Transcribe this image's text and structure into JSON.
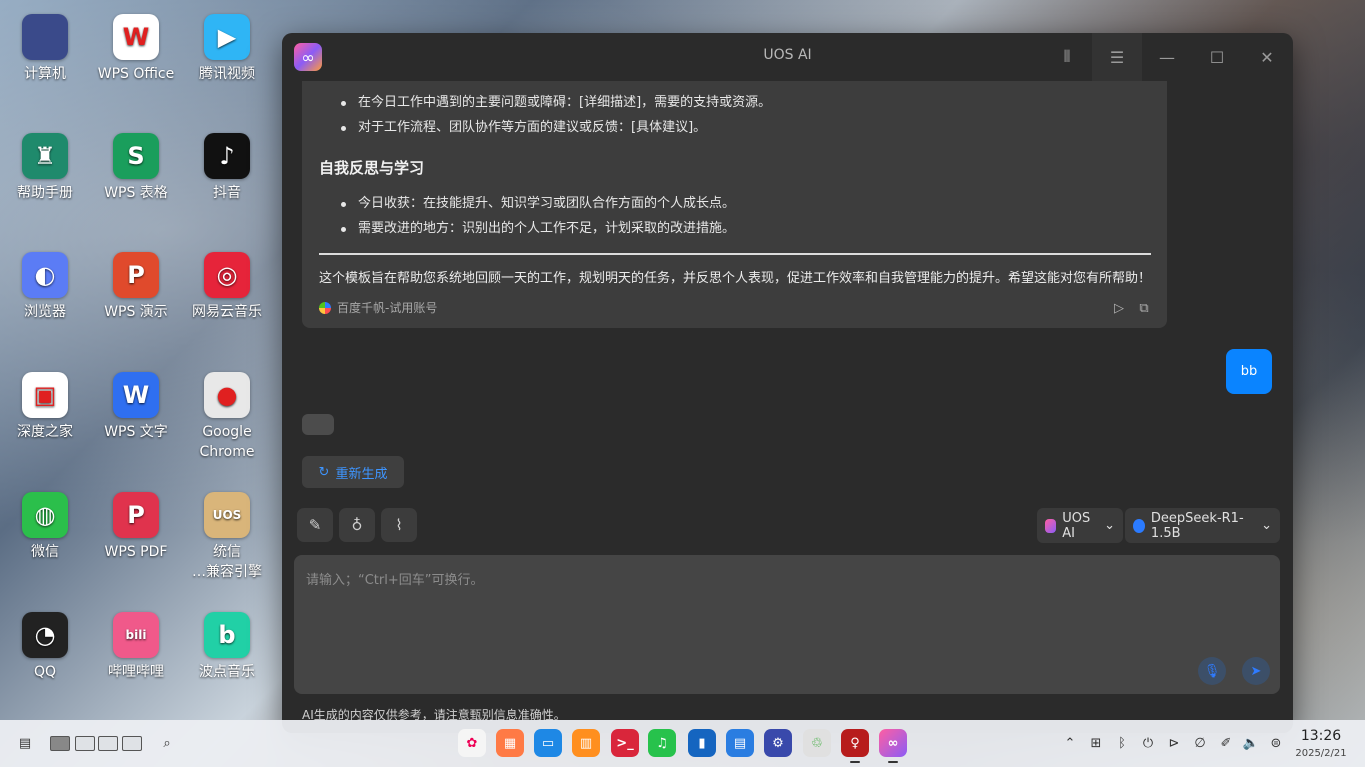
{
  "desktop": {
    "icons": [
      {
        "label": "计算机",
        "glyph": "",
        "color": "#3a4a8a"
      },
      {
        "label": "WPS Office",
        "glyph": "W",
        "color": "#ffffff"
      },
      {
        "label": "腾讯视频",
        "glyph": "▶",
        "color": "#2fb5f5"
      },
      {
        "label": "帮助手册",
        "glyph": "♜",
        "color": "#1f8a6c"
      },
      {
        "label": "WPS 表格",
        "glyph": "S",
        "color": "#1a9e5c"
      },
      {
        "label": "抖音",
        "glyph": "♪",
        "color": "#111111"
      },
      {
        "label": "浏览器",
        "glyph": "◐",
        "color": "#5b7cf5"
      },
      {
        "label": "WPS 演示",
        "glyph": "P",
        "color": "#e04a2c"
      },
      {
        "label": "网易云音乐",
        "glyph": "◎",
        "color": "#e6243a"
      },
      {
        "label": "深度之家",
        "glyph": "▣",
        "color": "#ffffff"
      },
      {
        "label": "WPS 文字",
        "glyph": "W",
        "color": "#2f6ff0"
      },
      {
        "label": "Google",
        "label2": "Chrome",
        "glyph": "●",
        "color": "#e8e8e8"
      },
      {
        "label": "微信",
        "glyph": "◍",
        "color": "#2bbf4b"
      },
      {
        "label": "WPS PDF",
        "glyph": "P",
        "color": "#e0334d"
      },
      {
        "label": "统信",
        "label2": "…兼容引擎",
        "glyph": "UOS",
        "color": "#d9b57a"
      },
      {
        "label": "QQ",
        "glyph": "◔",
        "color": "#222222"
      },
      {
        "label": "哔哩哔哩",
        "glyph": "bili",
        "color": "#f0598a"
      },
      {
        "label": "波点音乐",
        "glyph": "b",
        "color": "#21d0a6"
      }
    ]
  },
  "window": {
    "title": "UOS AI",
    "answer": {
      "bullets_top": [
        "在今日工作中遇到的主要问题或障碍：[详细描述]，需要的支持或资源。",
        "对于工作流程、团队协作等方面的建议或反馈：[具体建议]。"
      ],
      "section_heading": "自我反思与学习",
      "bullets_bottom": [
        "今日收获：在技能提升、知识学习或团队合作方面的个人成长点。",
        "需要改进的地方：识别出的个人工作不足，计划采取的改进措施。"
      ],
      "summary": "这个模板旨在帮助您系统地回顾一天的工作，规划明天的任务，并反思个人表现，促进工作效率和自我管理能力的提升。希望这能对您有所帮助！",
      "source": "百度千帆-试用账号"
    },
    "user_message": "bb",
    "regenerate_label": "重新生成",
    "assistant_selector": "UOS AI",
    "model_selector": "DeepSeek-R1-1.5B",
    "input_placeholder": "请输入；“Ctrl+回车”可换行。",
    "disclaimer": "AI生成的内容仅供参考，请注意甄别信息准确性。"
  },
  "taskbar": {
    "time": "13:26",
    "date": "2025/2/21"
  },
  "colors": {
    "accent": "#0a84ff",
    "link": "#3e95ff",
    "window_bg": "#2b2b2b",
    "card_bg": "#3d3d3d"
  }
}
